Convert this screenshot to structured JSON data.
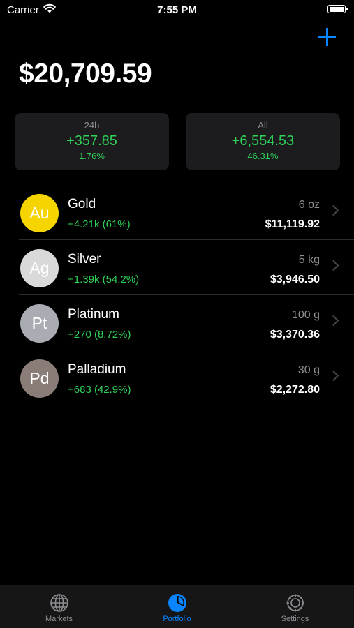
{
  "status": {
    "carrier": "Carrier",
    "time": "7:55 PM"
  },
  "total": "$20,709.59",
  "cards": [
    {
      "label": "24h",
      "value": "+357.85",
      "percent": "1.76%"
    },
    {
      "label": "All",
      "value": "+6,554.53",
      "percent": "46.31%"
    }
  ],
  "assets": [
    {
      "symbol": "Au",
      "name": "Gold",
      "change": "+4.21k (61%)",
      "qty": "6 oz",
      "value": "$11,119.92",
      "color": "#f5d400"
    },
    {
      "symbol": "Ag",
      "name": "Silver",
      "change": "+1.39k (54.2%)",
      "qty": "5 kg",
      "value": "$3,946.50",
      "color": "#d9d9d9"
    },
    {
      "symbol": "Pt",
      "name": "Platinum",
      "change": "+270 (8.72%)",
      "qty": "100 g",
      "value": "$3,370.36",
      "color": "#a9adb3"
    },
    {
      "symbol": "Pd",
      "name": "Palladium",
      "change": "+683 (42.9%)",
      "qty": "30 g",
      "value": "$2,272.80",
      "color": "#8a7d78"
    }
  ],
  "tabs": [
    {
      "label": "Markets",
      "icon": "globe-icon"
    },
    {
      "label": "Portfolio",
      "icon": "pie-chart-icon",
      "active": true
    },
    {
      "label": "Settings",
      "icon": "gear-icon"
    }
  ],
  "colors": {
    "accent": "#0a84ff",
    "positive": "#30d158",
    "background": "#000000",
    "card": "#1c1c1e"
  }
}
